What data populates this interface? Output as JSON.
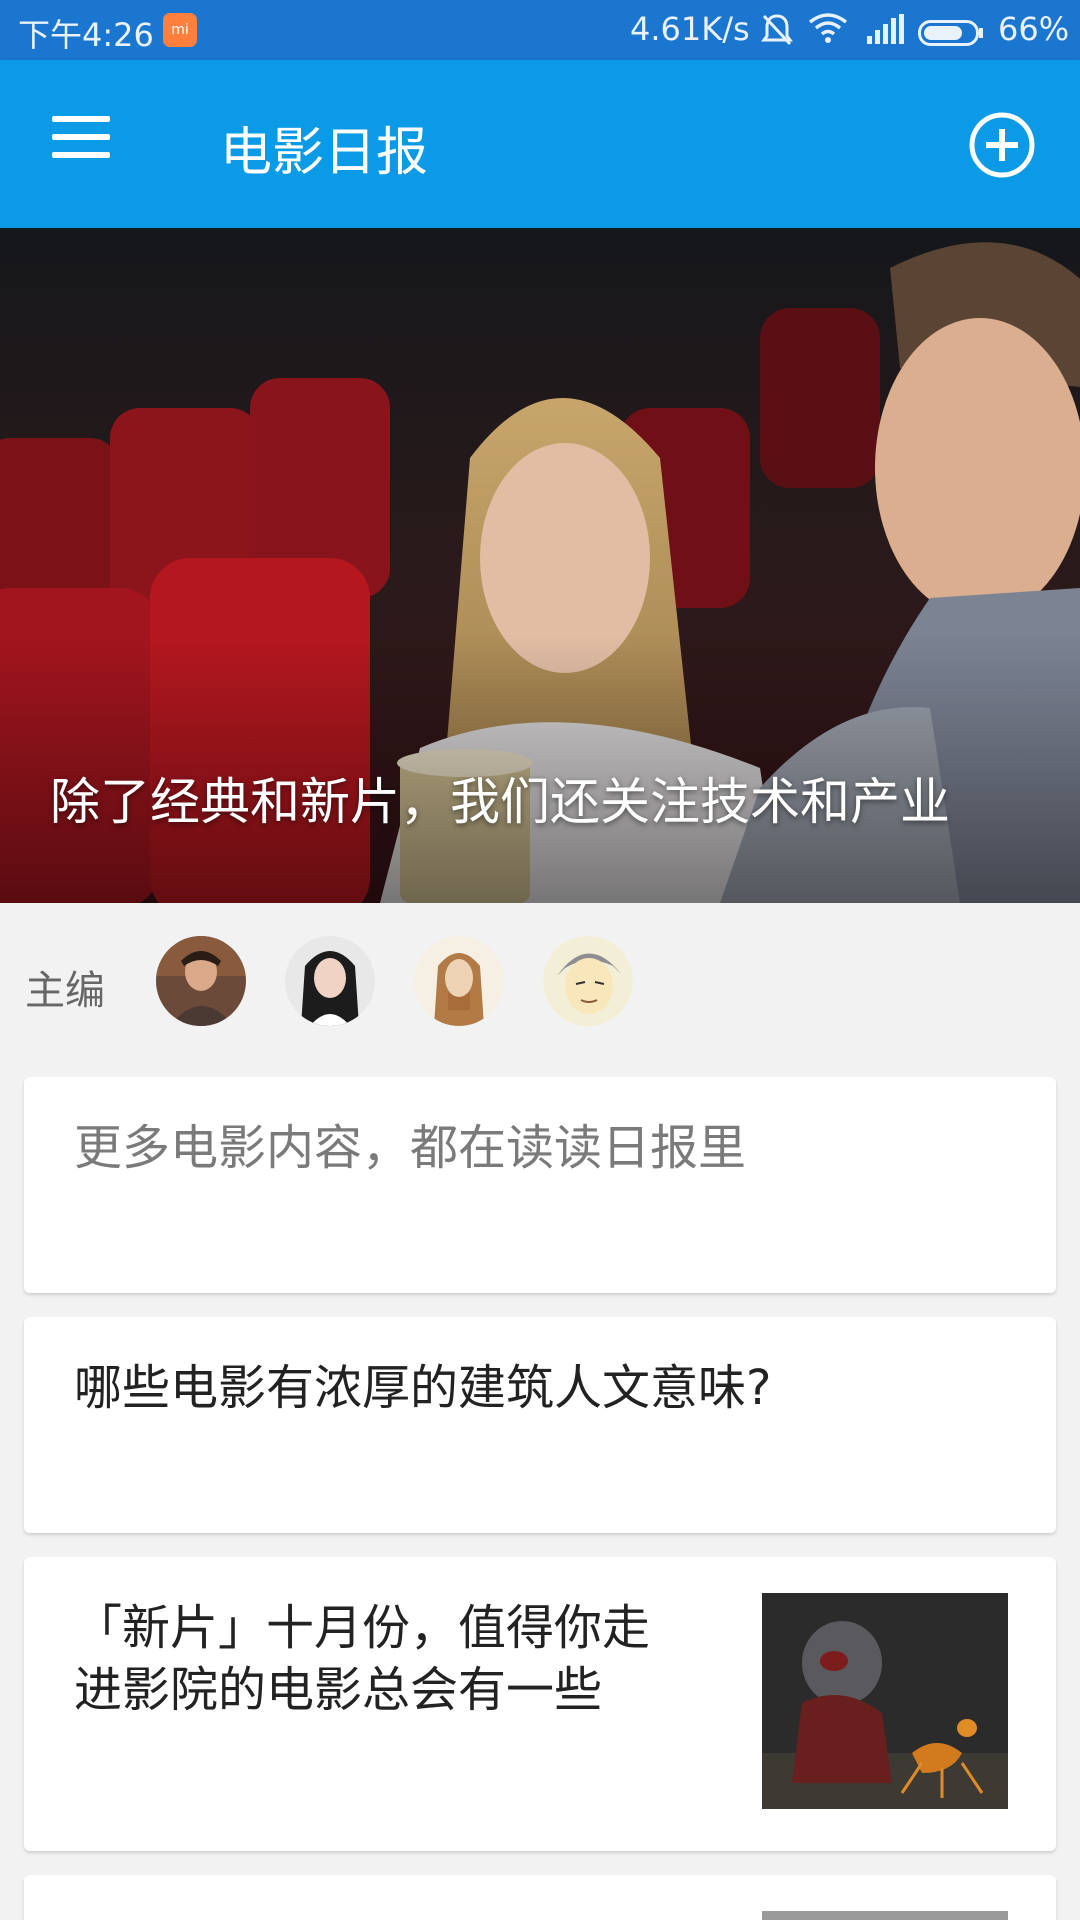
{
  "status_bar": {
    "time": "下午4:26",
    "speed": "4.61K/s",
    "battery": "66%",
    "icons": [
      "mi-icon",
      "bell-muted-icon",
      "wifi-icon",
      "signal-icon",
      "battery-icon"
    ]
  },
  "app_bar": {
    "title": "电影日报",
    "menu_icon": "menu-icon",
    "add_icon": "add-circle-icon",
    "color": "#0b9ae6"
  },
  "hero": {
    "caption": "除了经典和新片，我们还关注技术和产业"
  },
  "editors": {
    "label": "主编",
    "avatars": [
      "editor-avatar-1",
      "editor-avatar-2",
      "editor-avatar-3",
      "editor-avatar-4"
    ]
  },
  "cards": [
    {
      "text": "更多电影内容，都在读读日报里"
    },
    {
      "text": "哪些电影有浓厚的建筑人文意味?"
    },
    {
      "text_line1": "「新片」十月份，值得你走",
      "text_line2": "进影院的电影总会有一些"
    }
  ]
}
